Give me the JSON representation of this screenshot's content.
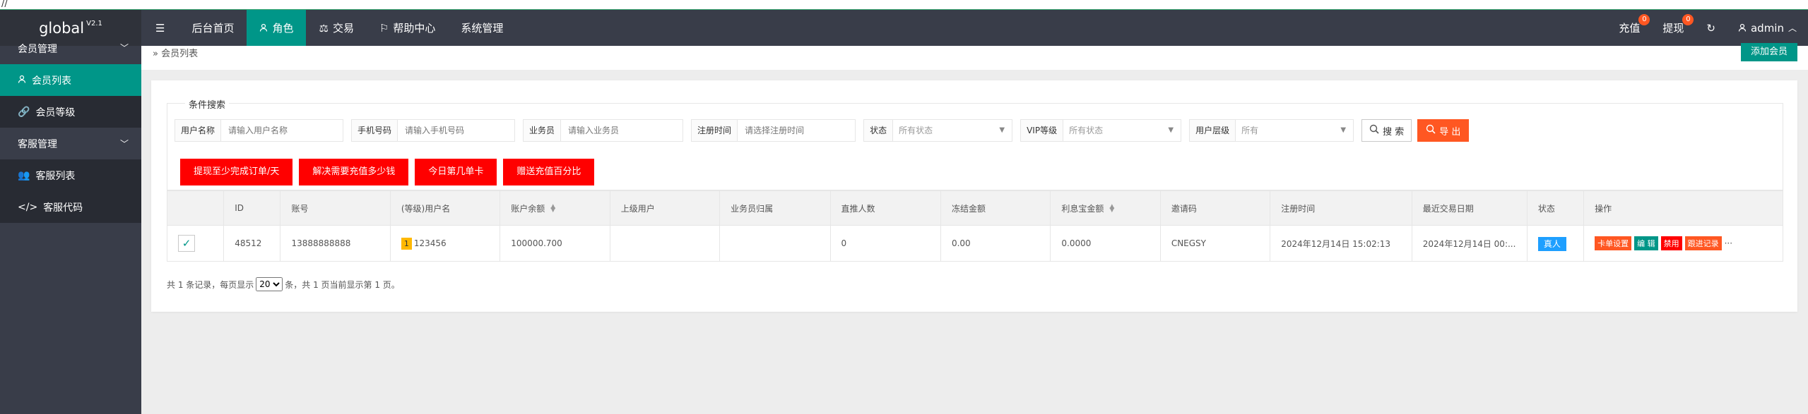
{
  "top_sliver": "//",
  "app": {
    "name": "global",
    "version": "V2.1"
  },
  "nav": {
    "items": [
      {
        "label": "后台首页"
      },
      {
        "label": "角色"
      },
      {
        "label": "交易"
      },
      {
        "label": "帮助中心"
      },
      {
        "label": "系统管理"
      }
    ],
    "recharge_label": "充值",
    "recharge_count": "0",
    "withdraw_label": "提现",
    "withdraw_count": "0",
    "user": "admin"
  },
  "sidebar": {
    "group1": "会员管理",
    "item_member_list": "会员列表",
    "item_member_level": "会员等级",
    "group2": "客服管理",
    "item_cs_list": "客服列表",
    "item_cs_code": "客服代码"
  },
  "breadcrumb": "会员列表",
  "add_button": "添加会员",
  "search": {
    "legend": "条件搜索",
    "username_label": "用户名称",
    "username_placeholder": "请输入用户名称",
    "phone_label": "手机号码",
    "phone_placeholder": "请输入手机号码",
    "agent_label": "业务员",
    "agent_placeholder": "请输入业务员",
    "regtime_label": "注册时间",
    "regtime_placeholder": "请选择注册时间",
    "status_label": "状态",
    "status_value": "所有状态",
    "vip_label": "VIP等级",
    "vip_value": "所有状态",
    "tier_label": "用户层级",
    "tier_value": "所有",
    "search_btn": "搜 索",
    "export_btn": "导 出"
  },
  "red_buttons": [
    "提现至少完成订单/天",
    "解决需要充值多少钱",
    "今日第几单卡",
    "赠送充值百分比"
  ],
  "table": {
    "headers": [
      "ID",
      "账号",
      "(等级)用户名",
      "账户余额",
      "上级用户",
      "业务员归属",
      "直推人数",
      "冻结金额",
      "利息宝金额",
      "邀请码",
      "注册时间",
      "最近交易日期",
      "状态",
      "操作"
    ],
    "rows": [
      {
        "id": "48512",
        "account": "13888888888",
        "level": "1",
        "username": "123456",
        "balance": "100000.700",
        "parent": "",
        "agent": "",
        "direct": "0",
        "frozen": "0.00",
        "interest": "0.0000",
        "invite": "CNEGSY",
        "regtime": "2024年12月14日 15:02:13",
        "lasttrade": "2024年12月14日 00:...",
        "status": "真人",
        "ops": [
          "卡单设置",
          "编 辑",
          "禁用",
          "跟进记录"
        ],
        "more": "···"
      }
    ]
  },
  "pager": {
    "prefix": "共 1 条记录，每页显示",
    "page_size": "20",
    "suffix": "条，共 1 页当前显示第 1 页。"
  },
  "colors": {
    "teal": "#009688",
    "dark": "#393d49",
    "orange": "#ff5722",
    "red": "#ff0000",
    "blue": "#1e9fff",
    "yellow": "#ffb800"
  }
}
